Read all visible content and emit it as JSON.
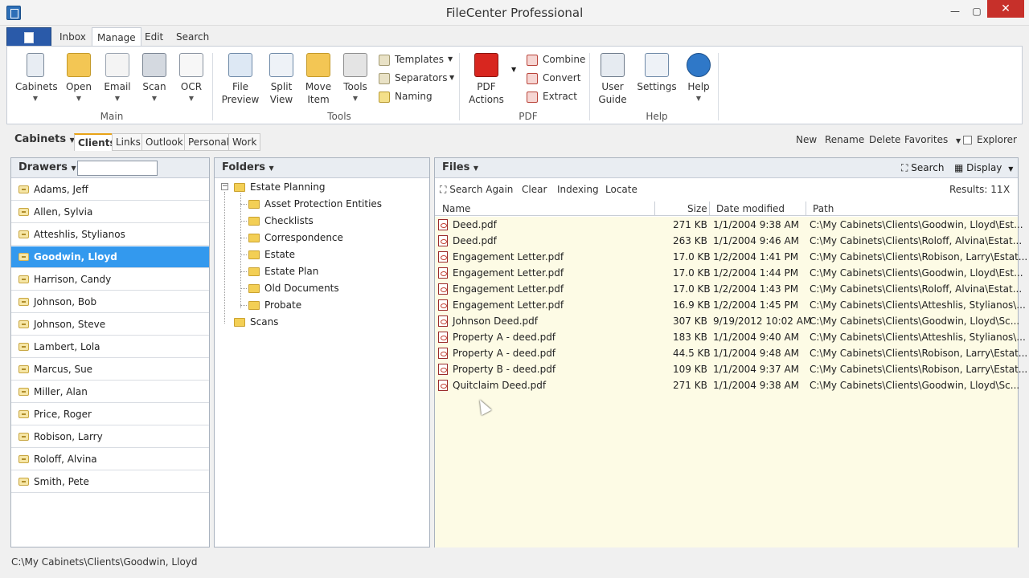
{
  "window": {
    "title": "FileCenter Professional"
  },
  "ribbon_tabs": [
    "Inbox",
    "Manage",
    "Edit",
    "Search"
  ],
  "ribbon": {
    "main": {
      "label": "Main",
      "buttons": [
        "Cabinets",
        "Open",
        "Email",
        "Scan",
        "OCR"
      ]
    },
    "tools": {
      "label": "Tools",
      "buttons": [
        "File\nPreview",
        "Split\nView",
        "Move\nItem",
        "Tools"
      ],
      "small": [
        "Templates",
        "Separators",
        "Naming"
      ]
    },
    "pdf": {
      "label": "PDF",
      "button": "PDF\nActions",
      "small": [
        "Combine",
        "Convert",
        "Extract"
      ]
    },
    "help": {
      "label": "Help",
      "buttons": [
        "User\nGuide",
        "Settings",
        "Help"
      ]
    }
  },
  "cabinets_bar": {
    "label": "Cabinets",
    "tabs": [
      "Clients",
      "Links",
      "Outlook",
      "Personal",
      "Work"
    ],
    "actions": [
      "New",
      "Rename",
      "Delete",
      "Favorites"
    ],
    "explorer": "Explorer"
  },
  "drawers": {
    "title": "Drawers",
    "items": [
      "Adams, Jeff",
      "Allen, Sylvia",
      "Atteshlis, Stylianos",
      "Goodwin, Lloyd",
      "Harrison, Candy",
      "Johnson, Bob",
      "Johnson, Steve",
      "Lambert, Lola",
      "Marcus, Sue",
      "Miller, Alan",
      "Price, Roger",
      "Robison, Larry",
      "Roloff, Alvina",
      "Smith, Pete"
    ]
  },
  "folders": {
    "title": "Folders",
    "root": "Estate Planning",
    "children": [
      "Asset Protection Entities",
      "Checklists",
      "Correspondence",
      "Estate",
      "Estate Plan",
      "Old Documents",
      "Probate"
    ],
    "other": "Scans",
    "expander": "−"
  },
  "files": {
    "title": "Files",
    "search": "Search",
    "display": "Display",
    "toolbar": [
      "Search Again",
      "Clear",
      "Indexing",
      "Locate"
    ],
    "results": "Results: 11",
    "close": "X",
    "columns": [
      "Name",
      "Size",
      "Date modified",
      "Path"
    ],
    "rows": [
      [
        "Deed.pdf",
        "271 KB",
        "1/1/2004 9:38 AM",
        "C:\\My Cabinets\\Clients\\Goodwin, Lloyd\\Est..."
      ],
      [
        "Deed.pdf",
        "263 KB",
        "1/1/2004 9:46 AM",
        "C:\\My Cabinets\\Clients\\Roloff, Alvina\\Estat..."
      ],
      [
        "Engagement Letter.pdf",
        "17.0 KB",
        "1/2/2004 1:41 PM",
        "C:\\My Cabinets\\Clients\\Robison, Larry\\Estat..."
      ],
      [
        "Engagement Letter.pdf",
        "17.0 KB",
        "1/2/2004 1:44 PM",
        "C:\\My Cabinets\\Clients\\Goodwin, Lloyd\\Est..."
      ],
      [
        "Engagement Letter.pdf",
        "17.0 KB",
        "1/2/2004 1:43 PM",
        "C:\\My Cabinets\\Clients\\Roloff, Alvina\\Estat..."
      ],
      [
        "Engagement Letter.pdf",
        "16.9 KB",
        "1/2/2004 1:45 PM",
        "C:\\My Cabinets\\Clients\\Atteshlis, Stylianos\\..."
      ],
      [
        "Johnson Deed.pdf",
        "307 KB",
        "9/19/2012 10:02 AM",
        "C:\\My Cabinets\\Clients\\Goodwin, Lloyd\\Sc..."
      ],
      [
        "Property A - deed.pdf",
        "183 KB",
        "1/1/2004 9:40 AM",
        "C:\\My Cabinets\\Clients\\Atteshlis, Stylianos\\..."
      ],
      [
        "Property A - deed.pdf",
        "44.5 KB",
        "1/1/2004 9:48 AM",
        "C:\\My Cabinets\\Clients\\Robison, Larry\\Estat..."
      ],
      [
        "Property B - deed.pdf",
        "109 KB",
        "1/1/2004 9:37 AM",
        "C:\\My Cabinets\\Clients\\Robison, Larry\\Estat..."
      ],
      [
        "Quitclaim Deed.pdf",
        "271 KB",
        "1/1/2004 9:38 AM",
        "C:\\My Cabinets\\Clients\\Goodwin, Lloyd\\Sc..."
      ]
    ]
  },
  "status": {
    "path": "C:\\My Cabinets\\Clients\\Goodwin, Lloyd"
  }
}
